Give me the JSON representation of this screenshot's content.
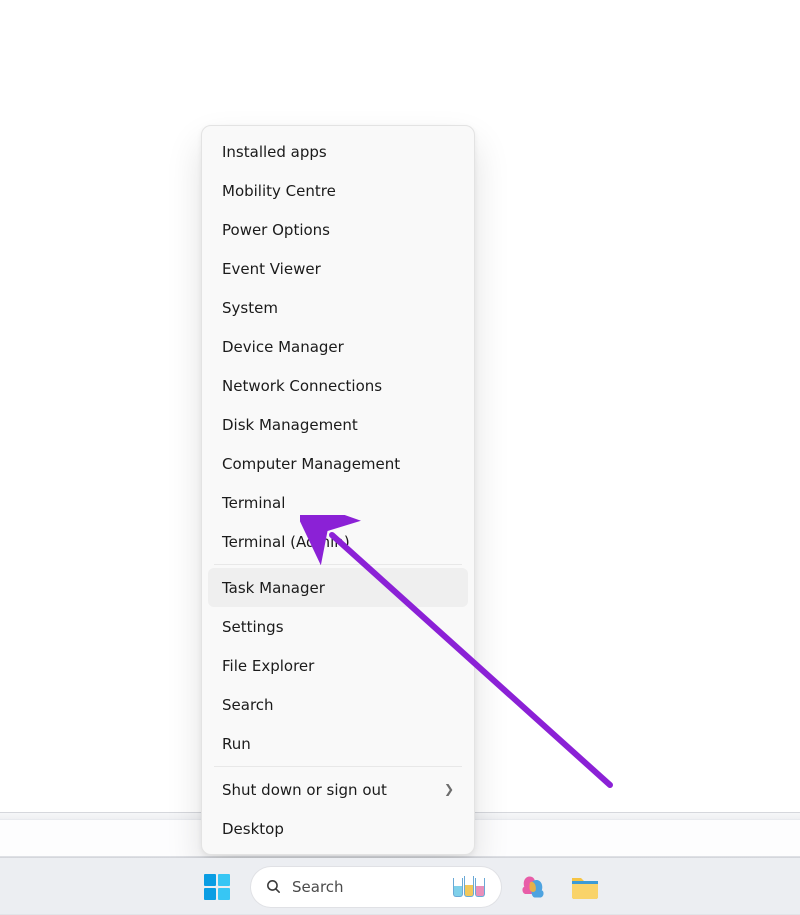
{
  "menu": {
    "groups": [
      {
        "items": [
          {
            "label": "Installed apps"
          },
          {
            "label": "Mobility Centre"
          },
          {
            "label": "Power Options"
          },
          {
            "label": "Event Viewer"
          },
          {
            "label": "System"
          },
          {
            "label": "Device Manager"
          },
          {
            "label": "Network Connections"
          },
          {
            "label": "Disk Management"
          },
          {
            "label": "Computer Management"
          },
          {
            "label": "Terminal"
          },
          {
            "label": "Terminal (Admin)"
          }
        ]
      },
      {
        "items": [
          {
            "label": "Task Manager",
            "highlight": true
          },
          {
            "label": "Settings"
          },
          {
            "label": "File Explorer"
          },
          {
            "label": "Search"
          },
          {
            "label": "Run"
          }
        ]
      },
      {
        "items": [
          {
            "label": "Shut down or sign out",
            "submenu": true
          },
          {
            "label": "Desktop"
          }
        ]
      }
    ]
  },
  "taskbar": {
    "search_placeholder": "Search"
  },
  "annotation": {
    "color": "#8b21d6"
  }
}
